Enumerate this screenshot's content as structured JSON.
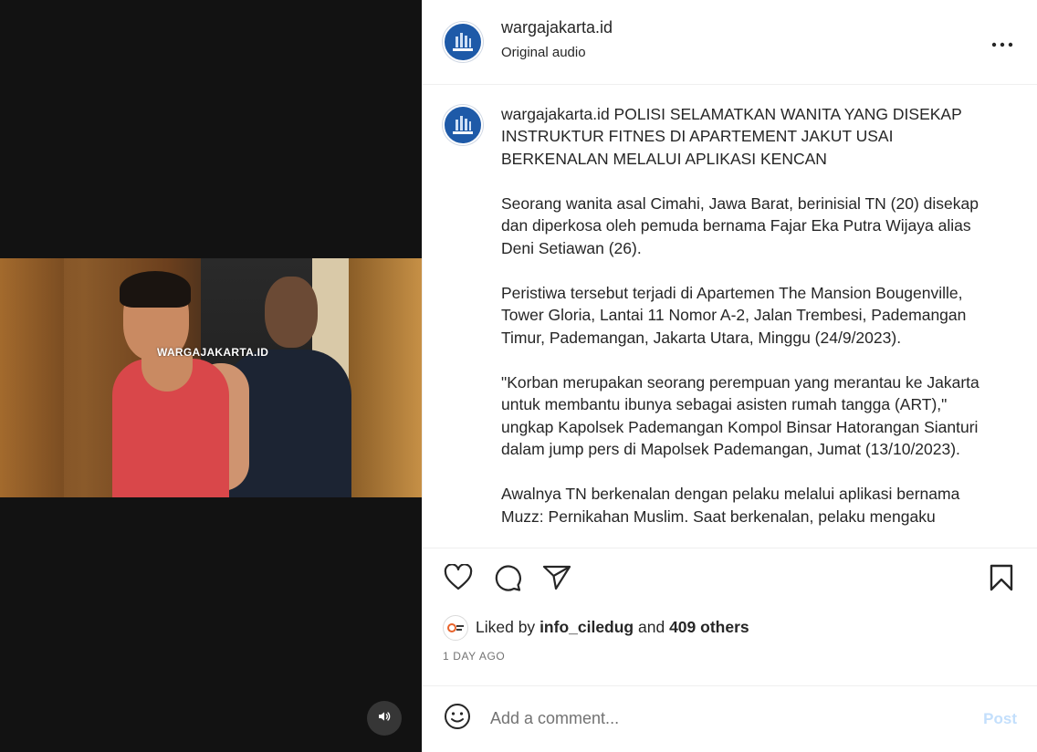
{
  "media": {
    "watermark": "WARGAJAKARTA.ID"
  },
  "header": {
    "username": "wargajakarta.id",
    "audio": "Original audio"
  },
  "caption": {
    "username": "wargajakarta.id",
    "headline": "POLISI SELAMATKAN WANITA YANG DISEKAP INSTRUKTUR FITNES DI APARTEMENT JAKUT USAI BERKENALAN MELALUI APLIKASI KENCAN",
    "paragraphs": [
      "Seorang wanita asal Cimahi, Jawa Barat, berinisial TN (20) disekap dan diperkosa oleh pemuda bernama Fajar Eka Putra Wijaya alias Deni Setiawan (26).",
      "Peristiwa tersebut terjadi di Apartemen The Mansion Bougenville, Tower Gloria, Lantai 11 Nomor A-2, Jalan Trembesi, Pademangan Timur, Pademangan, Jakarta Utara, Minggu (24/9/2023).",
      "\"Korban merupakan seorang perempuan yang merantau ke Jakarta untuk membantu ibunya sebagai asisten rumah tangga (ART),\" ungkap Kapolsek Pademangan Kompol Binsar Hatorangan Sianturi dalam jump pers di Mapolsek Pademangan, Jumat (13/10/2023).",
      "Awalnya TN berkenalan dengan pelaku melalui aplikasi bernama Muzz: Pernikahan Muslim. Saat berkenalan, pelaku mengaku"
    ]
  },
  "likes": {
    "prefix": "Liked by",
    "user": "info_ciledug",
    "conjunction": "and",
    "others": "409 others"
  },
  "timestamp": "1 DAY AGO",
  "comment": {
    "placeholder": "Add a comment...",
    "post_label": "Post"
  },
  "icons": {
    "like": "heart-icon",
    "comment": "comment-icon",
    "share": "paper-plane-icon",
    "save": "bookmark-icon",
    "more": "more-dots-icon",
    "audio": "speaker-icon",
    "emoji": "smiley-icon"
  },
  "colors": {
    "brand_blue": "#1e5aa8",
    "post_disabled": "#c3dffc",
    "muted": "#737373",
    "media_bg": "#121212"
  }
}
